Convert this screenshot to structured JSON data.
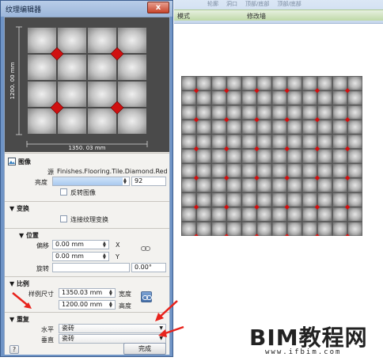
{
  "ribbon": {
    "top_items": [
      "轮廓",
      "洞口",
      "顶部/底部",
      "顶部/底部"
    ],
    "mode_label": "模式",
    "modify_label": "修改墙"
  },
  "dialog": {
    "title": "纹理编辑器",
    "close_glyph": "x",
    "preview": {
      "width_dim": "1350. 03 mm",
      "height_dim": "1200. 00 mm"
    },
    "image_section": {
      "header": "图像",
      "source_label": "源",
      "source_value": "Finishes.Flooring.Tile.Diamond.Red.pr",
      "brightness_label": "亮度",
      "brightness_value": "92",
      "brightness_percent": 92,
      "invert_label": "反转图像"
    },
    "transform_section": {
      "header": "变换",
      "link_label": "连接纹理变换"
    },
    "position_section": {
      "header": "位置",
      "offset_label": "偏移",
      "offset_x": "0.00 mm",
      "offset_y": "0.00 mm",
      "x_label": "X",
      "y_label": "Y",
      "rotation_label": "旋转",
      "rotation_value": "0.00°"
    },
    "scale_section": {
      "header": "比例",
      "sample_size_label": "样例尺寸",
      "width_value": "1350.03 mm",
      "height_value": "1200.00 mm",
      "width_label": "宽度",
      "height_label": "高度"
    },
    "repeat_section": {
      "header": "重复",
      "horizontal_label": "水平",
      "horizontal_value": "瓷砖",
      "vertical_label": "垂直",
      "vertical_value": "瓷砖"
    },
    "help_label": "?",
    "done_label": "完成"
  },
  "watermark": {
    "main": "BIM教程网",
    "sub": "www.ifbim.com"
  },
  "colors": {
    "diamond": "#d01010",
    "arrow": "#e8231c",
    "dialog_frame": "#6f94c6"
  }
}
